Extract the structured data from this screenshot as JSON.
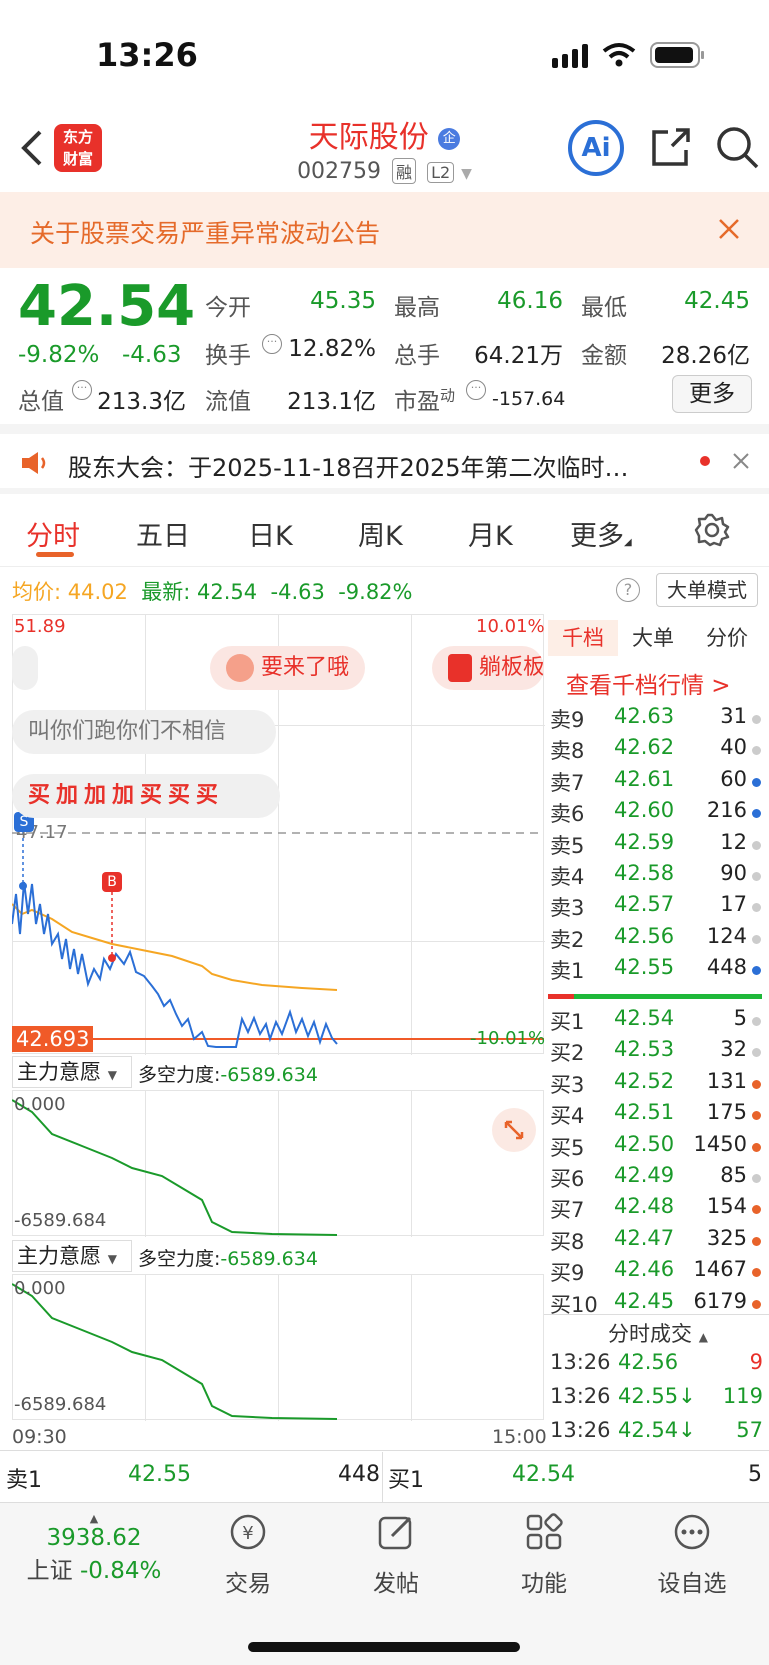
{
  "status": {
    "time": "13:26"
  },
  "header": {
    "title": "天际股份",
    "code": "002759",
    "tag_rong": "融",
    "tag_l2": "L2",
    "logo_line1": "东方",
    "logo_line2": "财富",
    "ai_label": "Ai"
  },
  "notice": {
    "text": "关于股票交易严重异常波动公告"
  },
  "quote": {
    "price": "42.54",
    "pct": "-9.82%",
    "change": "-4.63",
    "open_label": "今开",
    "open": "45.35",
    "high_label": "最高",
    "high": "46.16",
    "low_label": "最低",
    "low": "42.45",
    "turnover_label": "换手",
    "turnover": "12.82%",
    "volume_label": "总手",
    "volume": "64.21万",
    "amount_label": "金额",
    "amount": "28.26亿",
    "mktcap_label": "总值",
    "mktcap": "213.3亿",
    "float_label": "流值",
    "float": "213.1亿",
    "pe_label": "市盈",
    "pe_sup": "动",
    "pe": "-157.64",
    "more": "更多"
  },
  "announcement": {
    "text": "股东大会：于2025-11-18召开2025年第二次临时…"
  },
  "tabs": [
    "分时",
    "五日",
    "日K",
    "周K",
    "月K",
    "更多"
  ],
  "chart_header": {
    "avg_label": "均价:",
    "avg": "44.02",
    "latest_label": "最新:",
    "latest": "42.54",
    "change": "-4.63",
    "pct": "-9.82%",
    "mode": "大单模式"
  },
  "chart": {
    "y_top": "51.89",
    "pct_top": "10.01%",
    "dashed_price": "47.17",
    "current_price": "42.693",
    "pct_bottom": "-10.01%",
    "time_start": "09:30",
    "time_end": "15:00",
    "bubble1": "要来了哦",
    "bubble2": "躺板板",
    "bubble3": "叫你们跑你们不相信",
    "bubble4": "买加加加买买买",
    "marker_s": "S",
    "marker_b": "B"
  },
  "indicator1": {
    "name": "主力意愿",
    "label": "多空力度:",
    "value": "-6589.634",
    "top": "0.000",
    "bottom": "-6589.684"
  },
  "indicator2": {
    "name": "主力意愿",
    "label": "多空力度:",
    "value": "-6589.634",
    "top": "0.000",
    "bottom": "-6589.684"
  },
  "orderbook": {
    "tabs": [
      "千档",
      "大单",
      "分价"
    ],
    "link": "查看千档行情 >",
    "asks": [
      {
        "l": "卖9",
        "p": "42.63",
        "v": "31",
        "c": "#cccccc"
      },
      {
        "l": "卖8",
        "p": "42.62",
        "v": "40",
        "c": "#cccccc"
      },
      {
        "l": "卖7",
        "p": "42.61",
        "v": "60",
        "c": "#2b6fd6"
      },
      {
        "l": "卖6",
        "p": "42.60",
        "v": "216",
        "c": "#2b6fd6"
      },
      {
        "l": "卖5",
        "p": "42.59",
        "v": "12",
        "c": "#cccccc"
      },
      {
        "l": "卖4",
        "p": "42.58",
        "v": "90",
        "c": "#cccccc"
      },
      {
        "l": "卖3",
        "p": "42.57",
        "v": "17",
        "c": "#cccccc"
      },
      {
        "l": "卖2",
        "p": "42.56",
        "v": "124",
        "c": "#cccccc"
      },
      {
        "l": "卖1",
        "p": "42.55",
        "v": "448",
        "c": "#2b6fd6"
      }
    ],
    "bids": [
      {
        "l": "买1",
        "p": "42.54",
        "v": "5",
        "c": "#cccccc"
      },
      {
        "l": "买2",
        "p": "42.53",
        "v": "32",
        "c": "#cccccc"
      },
      {
        "l": "买3",
        "p": "42.52",
        "v": "131",
        "c": "#e8632a"
      },
      {
        "l": "买4",
        "p": "42.51",
        "v": "175",
        "c": "#e8632a"
      },
      {
        "l": "买5",
        "p": "42.50",
        "v": "1450",
        "c": "#e8632a"
      },
      {
        "l": "买6",
        "p": "42.49",
        "v": "85",
        "c": "#cccccc"
      },
      {
        "l": "买7",
        "p": "42.48",
        "v": "154",
        "c": "#e8632a"
      },
      {
        "l": "买8",
        "p": "42.47",
        "v": "325",
        "c": "#e8632a"
      },
      {
        "l": "买9",
        "p": "42.46",
        "v": "1467",
        "c": "#e8632a"
      },
      {
        "l": "买10",
        "p": "42.45",
        "v": "6179",
        "c": "#e8632a"
      }
    ],
    "trades_title": "分时成交",
    "trades": [
      {
        "t": "13:26",
        "p": "42.56",
        "v": "9",
        "vc": "#e8312a"
      },
      {
        "t": "13:26",
        "p": "42.55↓",
        "v": "119",
        "vc": "#1a9a2a"
      },
      {
        "t": "13:26",
        "p": "42.54↓",
        "v": "57",
        "vc": "#1a9a2a"
      }
    ]
  },
  "best": {
    "sell_label": "卖1",
    "sell_price": "42.55",
    "sell_vol": "448",
    "buy_label": "买1",
    "buy_price": "42.54",
    "buy_vol": "5"
  },
  "bottom_nav": {
    "index_value": "3938.62",
    "index_name": "上证",
    "index_pct": "-0.84%",
    "trade": "交易",
    "post": "发帖",
    "func": "功能",
    "watch": "设自选"
  }
}
